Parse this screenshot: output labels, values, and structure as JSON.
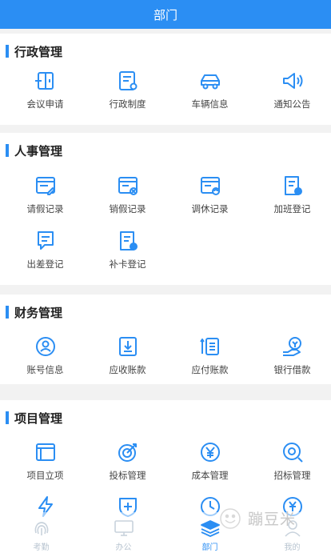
{
  "header": {
    "title": "部门"
  },
  "colors": {
    "accent": "#2b8ef3",
    "divider": "#f2f2f2"
  },
  "sections": [
    {
      "title": "行政管理",
      "items": [
        {
          "label": "会议申请",
          "icon": "meeting-door-icon"
        },
        {
          "label": "行政制度",
          "icon": "policy-document-icon"
        },
        {
          "label": "车辆信息",
          "icon": "car-icon"
        },
        {
          "label": "通知公告",
          "icon": "speaker-icon"
        }
      ]
    },
    {
      "title": "人事管理",
      "items": [
        {
          "label": "请假记录",
          "icon": "leave-edit-icon"
        },
        {
          "label": "销假记录",
          "icon": "leave-cancel-icon"
        },
        {
          "label": "调休记录",
          "icon": "shift-swap-icon"
        },
        {
          "label": "加班登记",
          "icon": "overtime-clock-icon"
        },
        {
          "label": "出差登记",
          "icon": "business-trip-icon"
        },
        {
          "label": "补卡登记",
          "icon": "card-supplement-icon"
        }
      ]
    },
    {
      "title": "财务管理",
      "items": [
        {
          "label": "账号信息",
          "icon": "account-user-icon"
        },
        {
          "label": "应收账款",
          "icon": "receivable-icon"
        },
        {
          "label": "应付账款",
          "icon": "payable-list-icon"
        },
        {
          "label": "银行借款",
          "icon": "bank-loan-icon"
        }
      ]
    },
    {
      "title": "项目管理",
      "items": [
        {
          "label": "项目立项",
          "icon": "project-folder-icon"
        },
        {
          "label": "投标管理",
          "icon": "bid-target-icon"
        },
        {
          "label": "成本管理",
          "icon": "cost-yen-icon"
        },
        {
          "label": "招标管理",
          "icon": "tender-search-icon"
        },
        {
          "label": "",
          "icon": "lightning-icon"
        },
        {
          "label": "",
          "icon": "shield-plus-icon"
        },
        {
          "label": "",
          "icon": "clock-icon"
        },
        {
          "label": "",
          "icon": "yen-exchange-icon"
        }
      ]
    }
  ],
  "tabbar": [
    {
      "label": "考勤",
      "icon": "fingerprint-icon",
      "active": false
    },
    {
      "label": "办公",
      "icon": "computer-icon",
      "active": false
    },
    {
      "label": "部门",
      "icon": "layers-icon",
      "active": true
    },
    {
      "label": "我的",
      "icon": "user-icon",
      "active": false
    }
  ],
  "watermark": {
    "text": "蹦豆米"
  }
}
